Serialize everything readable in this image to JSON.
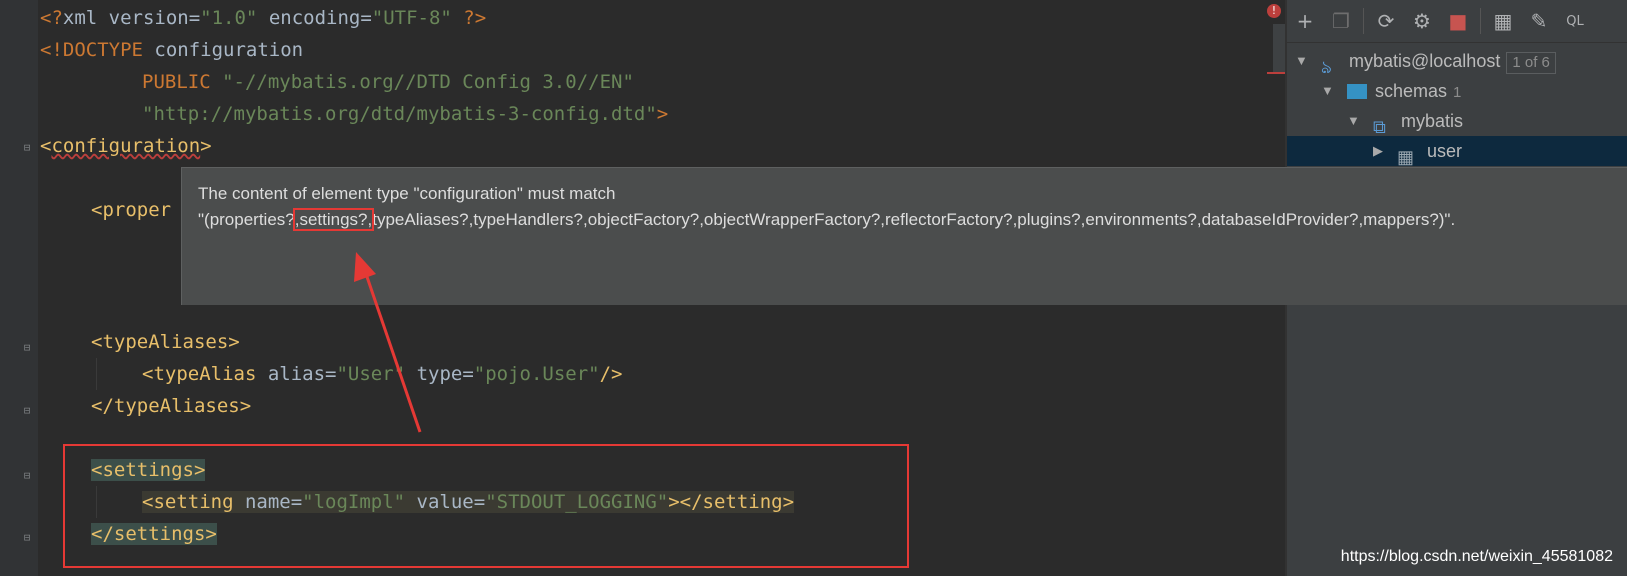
{
  "editor": {
    "lines": {
      "l1": {
        "p1": "<?",
        "p2": "xml version=",
        "p3": "\"1.0\"",
        "p4": " encoding=",
        "p5": "\"UTF-8\"",
        "p6": " ?>"
      },
      "l2": {
        "p1": "<!DOCTYPE",
        "p2": " configuration"
      },
      "l3": {
        "p1": "PUBLIC",
        "p2": " \"-//mybatis.org//DTD Config 3.0//EN\""
      },
      "l4": {
        "p1": "\"http://mybatis.org/dtd/mybatis-3-config.dtd\"",
        "p2": ">"
      },
      "l5": {
        "p1": "<",
        "p2": "configuration",
        "p3": ">"
      },
      "l6": {
        "p1": "<proper"
      },
      "l7": {
        "p1": "<typeAliases>"
      },
      "l8": {
        "p1": "<typeAlias ",
        "p2": "alias=",
        "p3": "\"User\"",
        "p4": " type=",
        "p5": "\"pojo.User\"",
        "p6": "/>"
      },
      "l9": {
        "p1": "</typeAliases>"
      },
      "l10": {
        "p1": "<settings>"
      },
      "l11": {
        "p1": "<setting ",
        "p2": "name=",
        "p3": "\"logImpl\"",
        "p4": " value=",
        "p5": "\"STDOUT_LOGGING\"",
        "p6": "></setting>"
      },
      "l12": {
        "p1": "</settings>"
      }
    }
  },
  "tooltip": {
    "line1": "The content of element type \"configuration\" must match",
    "line2_before": "\"(properties?",
    "line2_highlight": ",settings?,",
    "line2_after": "typeAliases?,typeHandlers?,objectFactory?,objectWrapperFactory?,reflectorFactory?,plugins?,environments?,databaseIdProvider?,mappers?)\"."
  },
  "database_panel": {
    "toolbar_icons": [
      "add-icon",
      "copy-icon",
      "refresh-icon",
      "schema-sync-icon",
      "stop-icon",
      "table-icon",
      "edit-icon",
      "console-icon"
    ],
    "tree": {
      "datasource": {
        "label": "mybatis@localhost",
        "badge": "1 of 6"
      },
      "schemas": {
        "label": "schemas",
        "count": "1"
      },
      "schema": {
        "label": "mybatis"
      },
      "table": {
        "label": "user"
      }
    }
  },
  "watermark": "https://blog.csdn.net/weixin_45581082",
  "colors": {
    "accent_red": "#e53935",
    "tag": "#e8bf6a",
    "string": "#6a8759",
    "keyword": "#cc7832"
  }
}
